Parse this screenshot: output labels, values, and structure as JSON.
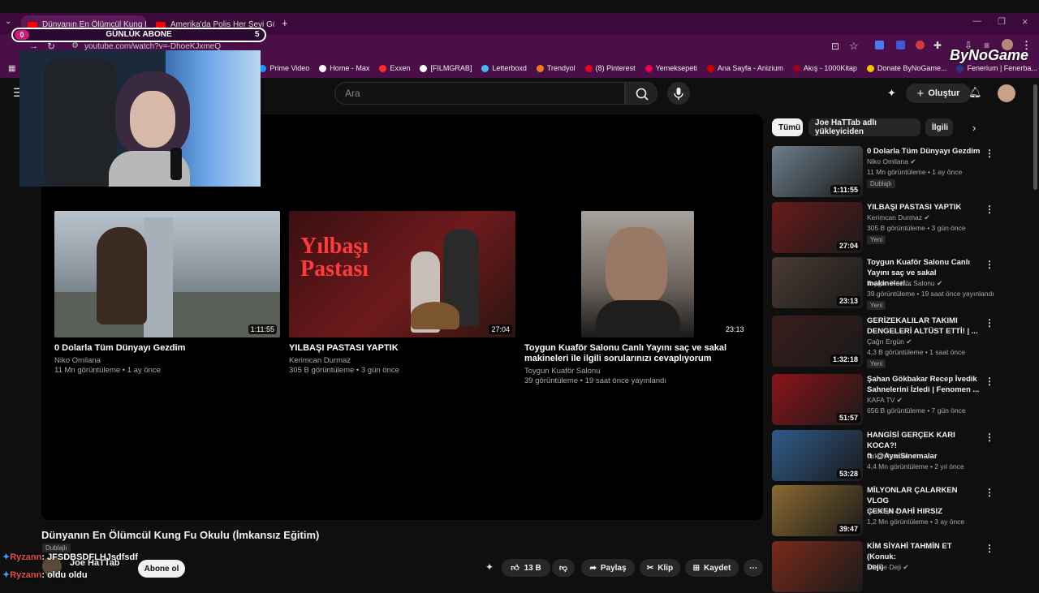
{
  "browser": {
    "tabs": [
      {
        "label": "Dünyanın En Ölümcül Kung Fu"
      },
      {
        "label": "Amerika'da Polis Her Şeyi Görü"
      }
    ],
    "url": "youtube.com/watch?v=-DhoeKJxmeQ",
    "bookmarks": [
      {
        "label": "Prime Video",
        "color": "#1a98ff"
      },
      {
        "label": "Home - Max",
        "color": "#ffffff"
      },
      {
        "label": "Exxen",
        "color": "#ff2a2a"
      },
      {
        "label": "[FILMGRAB]",
        "color": "#ffffff"
      },
      {
        "label": "Letterboxd",
        "color": "#40bcf4"
      },
      {
        "label": "Trendyol",
        "color": "#f27a1a"
      },
      {
        "label": "(8) Pinterest",
        "color": "#e60023"
      },
      {
        "label": "Yemeksepeti",
        "color": "#ea004b"
      },
      {
        "label": "Ana Sayfa - Anizium",
        "color": "#d00000"
      },
      {
        "label": "Akış - 1000Kitap",
        "color": "#a00020"
      },
      {
        "label": "Donate ByNoGame...",
        "color": "#f2c200"
      },
      {
        "label": "Fenerium | Fenerba...",
        "color": "#1e3a8a"
      }
    ]
  },
  "overlay": {
    "sub_goal_label": "GÜNLÜK ABONE",
    "sub_goal_current": "0",
    "sub_goal_target": "5",
    "watermark": "ByNoGame",
    "chat": [
      {
        "user": "Ryzann",
        "message": ": JFSDBSDFLHJsdfsdf"
      },
      {
        "user": "Ryzann",
        "message": ": oldu oldu"
      }
    ]
  },
  "header": {
    "search_placeholder": "Ara",
    "create_label": "Oluştur"
  },
  "endscreen": [
    {
      "title": "0 Dolarla Tüm Dünyayı Gezdim",
      "channel": "Niko Omilana",
      "meta": "11 Mn görüntüleme • 1 ay önce",
      "duration": "1:11:55"
    },
    {
      "title": "YILBAŞI PASTASI YAPTIK",
      "channel": "Kerimcan Durmaz",
      "meta": "305 B görüntüleme • 3 gün önce",
      "duration": "27:04"
    },
    {
      "title_line1": "Toygun Kuaför Salonu Canlı Yayını saç ve sakal",
      "title_line2": "makineleri ile ilgili sorularınızı cevaplıyorum",
      "channel": "Toygun Kuaför Salonu",
      "meta": "39 görüntüleme • 19 saat önce yayınlandı",
      "duration": "23:13"
    }
  ],
  "video": {
    "title": "Dünyanın En Ölümcül Kung Fu Okulu (İmkansız Eğitim)",
    "dub_badge": "Dublajlı",
    "channel": "Joe HaTTab",
    "subscribe_label": "Abone ol",
    "like_count": "13 B",
    "share_label": "Paylaş",
    "clip_label": "Klip",
    "save_label": "Kaydet"
  },
  "sidebar": {
    "chips": [
      "Tümü",
      "Joe HaTTab adlı yükleyiciden",
      "İlgili"
    ],
    "items": [
      {
        "title1": "0 Dolarla Tüm Dünyayı Gezdim",
        "title2": "",
        "channel": "Niko Omilana",
        "meta": "11 Mn görüntüleme • 1 ay önce",
        "badge": "Dublajlı",
        "duration": "1:11:55",
        "thumb_color": "#6d7e8c"
      },
      {
        "title1": "YILBAŞI PASTASI YAPTIK",
        "title2": "",
        "channel": "Kerimcan Durmaz",
        "meta": "305 B görüntüleme • 3 gün önce",
        "badge": "Yeni",
        "duration": "27:04",
        "thumb_color": "#6a1a1a"
      },
      {
        "title1": "Toygun Kuaför Salonu Canlı",
        "title2": "Yayını  saç ve sakal makineleri...",
        "channel": "Toygun Kuaför Salonu",
        "meta": "39 görüntüleme • 19 saat önce yayınlandı",
        "badge": "Yeni",
        "duration": "23:13",
        "thumb_color": "#4a3a32"
      },
      {
        "title1": "GERİZEKALILAR TAKIMI",
        "title2": "DENGELERİ ALTÜST ETTİ! | ...",
        "channel": "Çağrı Ergün",
        "meta": "4,3 B görüntüleme • 1 saat önce",
        "badge": "Yeni",
        "duration": "1:32:18",
        "thumb_color": "#3a1c1c"
      },
      {
        "title1": "Şahan Gökbakar Recep İvedik",
        "title2": "Sahnelerini İzledi | Fenomen ...",
        "channel": "KAFA TV",
        "meta": "656 B görüntüleme • 7 gün önce",
        "badge": "",
        "duration": "51:57",
        "thumb_color": "#8a1418"
      },
      {
        "title1": "HANGİSİ GERÇEK KARI KOCA?!",
        "title2": "ft. @AyniSinemalar",
        "channel": "Orkun Işıtmak",
        "meta": "4,4 Mn görüntüleme • 2 yıl önce",
        "badge": "",
        "duration": "53:28",
        "thumb_color": "#2f5a8a"
      },
      {
        "title1": "MİLYONLAR ÇALARKEN VLOG",
        "title2": "ÇEKEN DAHİ HIRSIZ",
        "channel": "Bentropi",
        "meta": "1,2 Mn görüntüleme • 3 ay önce",
        "badge": "",
        "duration": "39:47",
        "thumb_color": "#8a6a30"
      },
      {
        "title1": "KİM SİYAHİ TAHMİN ET (Konuk:",
        "title2": "Deji)",
        "channel": "KSI ve Deji",
        "meta": "",
        "badge": "",
        "duration": "",
        "thumb_color": "#7a2a1a"
      }
    ]
  }
}
